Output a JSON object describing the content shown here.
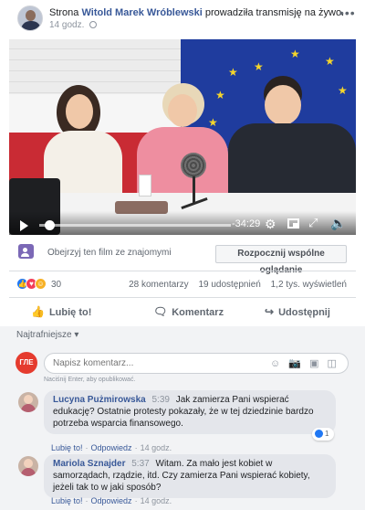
{
  "header": {
    "prefix": "Strona",
    "page_name": "Witold Marek Wróblewski",
    "suffix": "prowadziła transmisję na żywo.",
    "time": "14 godz.",
    "more": "•••"
  },
  "video": {
    "time_remaining": "-34:29",
    "progress_percent": 3
  },
  "watch_party": {
    "text": "Obejrzyj ten film ze znajomymi",
    "button": "Rozpocznij wspólne oglądanie"
  },
  "stats": {
    "reactions_count": "30",
    "comments": "28 komentarzy",
    "shares": "19 udostępnień",
    "views": "1,2 tys. wyświetleń"
  },
  "actions": {
    "like": "Lubię to!",
    "comment": "Komentarz",
    "share": "Udostępnij"
  },
  "comments_section": {
    "sort": "Najtrafniejsze",
    "input_placeholder": "Napisz komentarz...",
    "input_hint": "Naciśnij Enter, aby opublikować.",
    "input_avatar_text": "ГЛЕ"
  },
  "comments": [
    {
      "author": "Lucyna Pużmirowska",
      "time": "5:39",
      "text": "Jak zamierza Pani wspierać edukację? Ostatnie protesty pokazały, że w tej dziedzinie bardzo potrzeba wsparcia finansowego.",
      "like": "Lubię to!",
      "reply": "Odpowiedz",
      "age": "14 godz.",
      "likes": "1"
    },
    {
      "author": "Mariola Sznajder",
      "time": "5:37",
      "text": "Witam. Za mało jest kobiet w samorządach, rządzie, itd. Czy zamierza Pani wspierać kobiety, jeżeli tak to w jaki sposób?",
      "like": "Lubię to!",
      "reply": "Odpowiedz",
      "age": "14 godz."
    }
  ],
  "colors": {
    "link_blue": "#385898",
    "like_blue": "#2078f4",
    "bubble_gray": "#e4e6eb"
  }
}
